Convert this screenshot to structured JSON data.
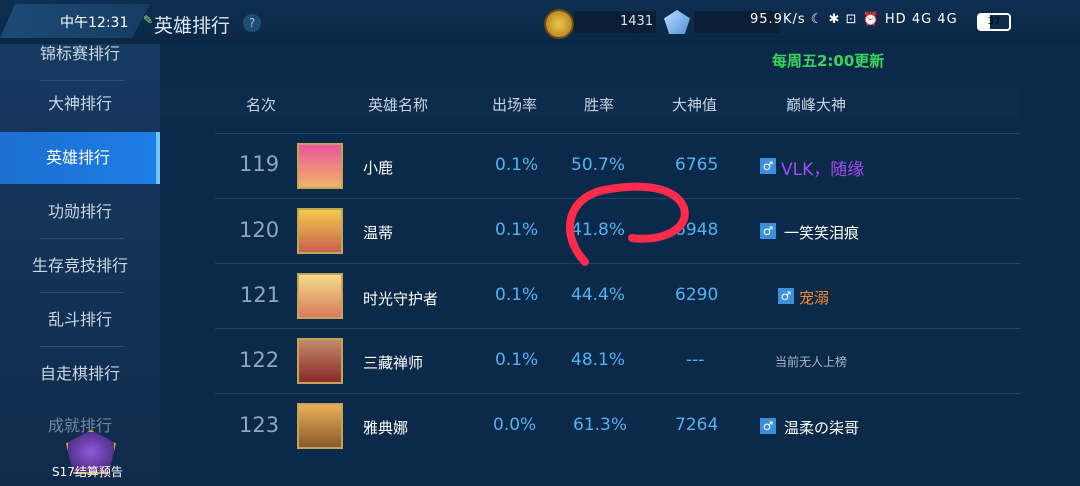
{
  "status": {
    "time": "中午12:31",
    "right_icons": "95.9K/s ☾ ✱ ⊡ ⏰ HD 4G 4G",
    "battery": "37"
  },
  "header": {
    "title": "英雄排行",
    "help": "?",
    "gold": "1431"
  },
  "sidebar": {
    "items": [
      {
        "label": "锦标赛排行"
      },
      {
        "label": "大神排行"
      },
      {
        "label": "英雄排行"
      },
      {
        "label": "功勋排行"
      },
      {
        "label": "生存竞技排行"
      },
      {
        "label": "乱斗排行"
      },
      {
        "label": "自走棋排行"
      },
      {
        "label": "成就排行"
      }
    ],
    "season_label": "S17结算预告"
  },
  "main": {
    "update_note": "每周五2:00更新",
    "columns": [
      "名次",
      "英雄名称",
      "出场率",
      "胜率",
      "大神值",
      "巅峰大神"
    ],
    "rows": [
      {
        "rank": "119",
        "name": "小鹿",
        "pick": "0.1%",
        "win": "50.7%",
        "score": "6765",
        "player": "VLK，随缘",
        "player_color": "#a24bf0"
      },
      {
        "rank": "120",
        "name": "温蒂",
        "pick": "0.1%",
        "win": "41.8%",
        "score": "6948",
        "player": "一笑笑泪痕",
        "player_color": "#ffffff"
      },
      {
        "rank": "121",
        "name": "时光守护者",
        "pick": "0.1%",
        "win": "44.4%",
        "score": "6290",
        "player": "宠溺",
        "player_color": "#ff8c2a"
      },
      {
        "rank": "122",
        "name": "三藏禅师",
        "pick": "0.1%",
        "win": "48.1%",
        "score": "---",
        "player": "当前无人上榜",
        "player_color": "#a9b8c9"
      },
      {
        "rank": "123",
        "name": "雅典娜",
        "pick": "0.0%",
        "win": "61.3%",
        "score": "7264",
        "player": "温柔の柒哥",
        "player_color": "#ffffff"
      }
    ]
  },
  "colors": {
    "accent_blue": "#4fb3f2",
    "active_tab": "#1d7de6",
    "update_green": "#39d45d",
    "annotation_red": "#ff2b4a"
  }
}
